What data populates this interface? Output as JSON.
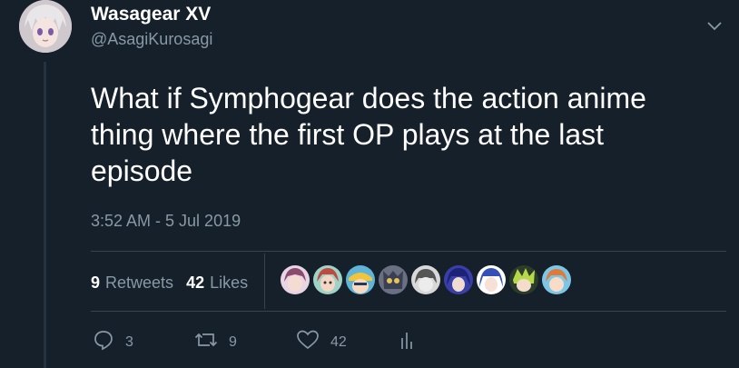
{
  "tweet": {
    "display_name": "Wasagear XV",
    "handle": "@AsagiKurosagi",
    "text": "What if Symphogear does the action anime thing where the first OP plays at the last episode",
    "timestamp": "3:52 AM - 5 Jul 2019"
  },
  "stats": {
    "retweets_count": "9",
    "retweets_label": "Retweets",
    "likes_count": "42",
    "likes_label": "Likes"
  },
  "actions": {
    "reply_count": "3",
    "retweet_count": "9",
    "like_count": "42"
  },
  "icons": {
    "menu": "chevron-down-icon",
    "reply": "reply-icon",
    "retweet": "retweet-icon",
    "like": "heart-icon",
    "analytics": "analytics-icon"
  },
  "colors": {
    "background": "#15202b",
    "muted_text": "#8899a6",
    "divider": "#38444d",
    "thread_line": "#253341"
  }
}
